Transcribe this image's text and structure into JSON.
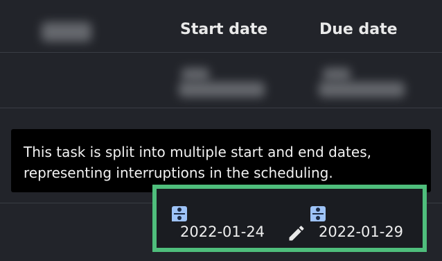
{
  "table": {
    "columns": [
      {
        "label": "Start date"
      },
      {
        "label": "Due date"
      }
    ]
  },
  "tooltip": {
    "text": "This task is split into multiple start and end dates, representing interruptions in the scheduling."
  },
  "row": {
    "start_date": "2022-01-24",
    "due_date": "2022-01-29",
    "start_icon": "split-schedule-icon",
    "due_icon": "split-schedule-icon",
    "edit_icon": "pencil-icon"
  },
  "colors": {
    "background": "#22242a",
    "tooltip": "#000000",
    "highlight_border": "#4fbe7c",
    "split_icon": "#9ec3f7"
  }
}
